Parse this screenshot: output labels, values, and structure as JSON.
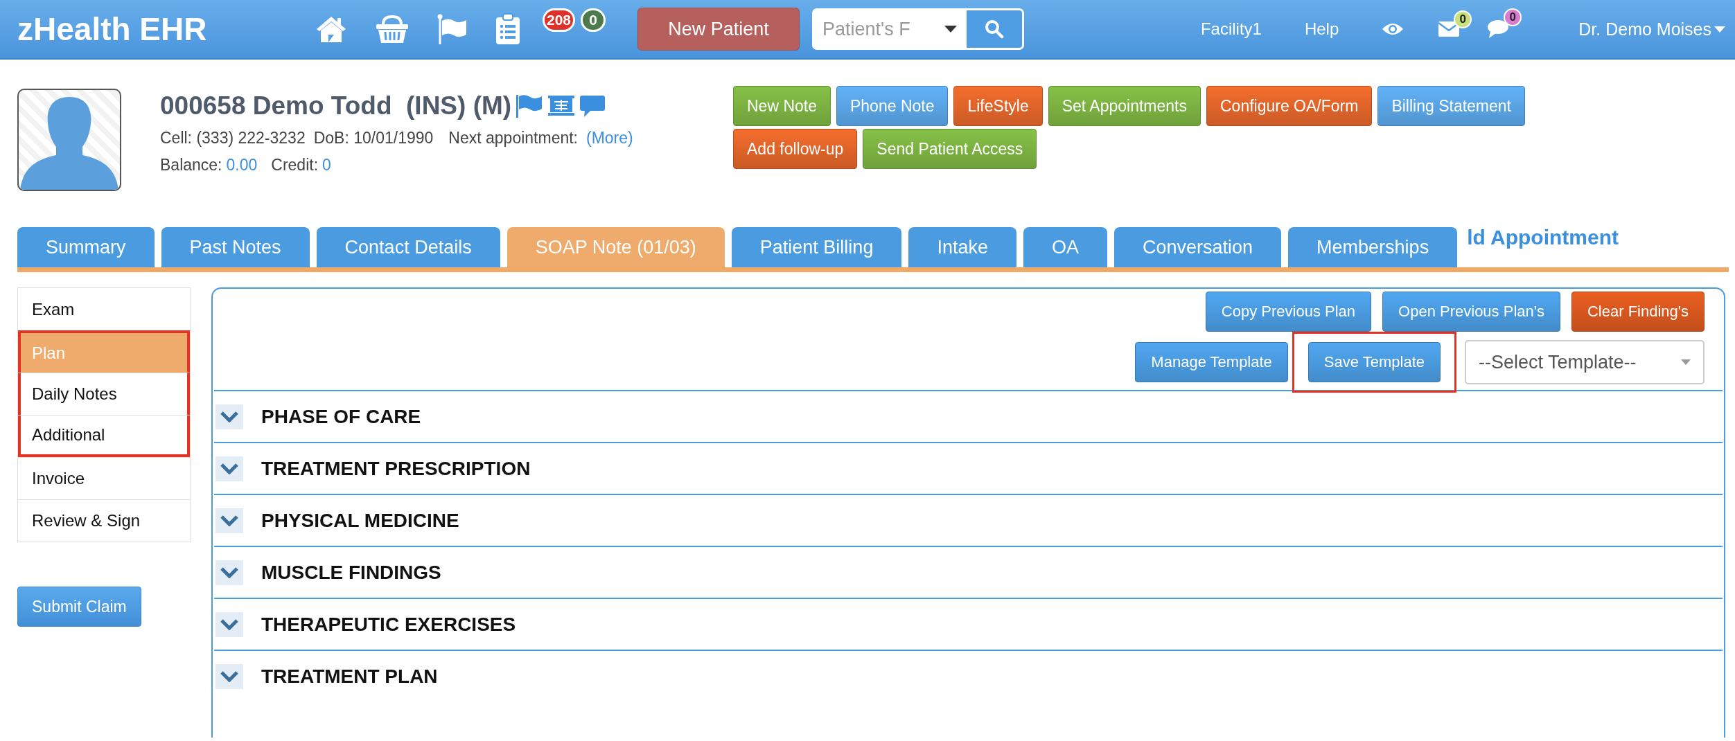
{
  "header": {
    "logo": "zHealth EHR",
    "badges": [
      {
        "count": "208",
        "color": "#e0302a"
      },
      {
        "count": "0",
        "color": "#4d7a4a"
      }
    ],
    "new_patient": "New Patient",
    "search": {
      "placeholder": "Patient's F"
    },
    "links": [
      "Facility1",
      "Help"
    ],
    "notify": [
      {
        "count": "0",
        "color": "#c9e07a"
      },
      {
        "count": "0",
        "color": "#d97bd0"
      }
    ],
    "user": "Dr. Demo Moises"
  },
  "patient": {
    "name": "000658 Demo Todd  (INS) (M)",
    "cell_label": "Cell:",
    "cell": "(333) 222-3232",
    "dob_label": "DoB:",
    "dob": "10/01/1990",
    "next_label": "Next appointment:",
    "next_link": "(More)",
    "balance_label": "Balance:",
    "balance": "0.00",
    "credit_label": "Credit:",
    "credit": "0",
    "actions": [
      [
        {
          "label": "New Note",
          "color": "#7cb342"
        },
        {
          "label": "Phone Note",
          "color": "#5aa5e6"
        },
        {
          "label": "LifeStyle",
          "color": "#e2652a"
        },
        {
          "label": "Set Appointments",
          "color": "#7cb342"
        },
        {
          "label": "Configure OA/Form",
          "color": "#e2652a"
        },
        {
          "label": "Billing Statement",
          "color": "#5aa5e6"
        }
      ],
      [
        {
          "label": "Add follow-up",
          "color": "#e2652a"
        },
        {
          "label": "Send Patient Access",
          "color": "#7cb342"
        }
      ]
    ]
  },
  "tabs": [
    {
      "label": "Summary",
      "selected": false
    },
    {
      "label": "Past Notes",
      "selected": false
    },
    {
      "label": "Contact Details",
      "selected": false
    },
    {
      "label": "SOAP Note (01/03)",
      "selected": true
    },
    {
      "label": "Patient Billing",
      "selected": false
    },
    {
      "label": "Intake",
      "selected": false
    },
    {
      "label": "OA",
      "selected": false
    },
    {
      "label": "Conversation",
      "selected": false
    },
    {
      "label": "Memberships",
      "selected": false
    }
  ],
  "tab_trailing_link": "ld Appointment",
  "sidebar": {
    "items": [
      {
        "label": "Exam",
        "selected": false,
        "highlighted": false
      },
      {
        "label": "Plan",
        "selected": true,
        "highlighted": true
      },
      {
        "label": "Daily Notes",
        "selected": false,
        "highlighted": true
      },
      {
        "label": "Additional",
        "selected": false,
        "highlighted": true
      },
      {
        "label": "Invoice",
        "selected": false,
        "highlighted": false
      },
      {
        "label": "Review & Sign",
        "selected": false,
        "highlighted": false
      }
    ],
    "submit": "Submit Claim"
  },
  "plan": {
    "toolbar": [
      [
        {
          "label": "Copy Previous Plan",
          "color": "#4a9be0",
          "highlighted": false
        },
        {
          "label": "Open Previous Plan's",
          "color": "#4a9be0",
          "highlighted": false
        },
        {
          "label": "Clear Finding's",
          "color": "#d9581f",
          "highlighted": false
        }
      ],
      [
        {
          "label": "Manage Template",
          "color": "#4a9be0",
          "highlighted": false
        },
        {
          "label": "Save Template",
          "color": "#4a9be0",
          "highlighted": true
        }
      ]
    ],
    "template_select": "--Select Template--",
    "sections": [
      "PHASE OF CARE",
      "TREATMENT PRESCRIPTION",
      "PHYSICAL MEDICINE",
      "MUSCLE FINDINGS",
      "THERAPEUTIC EXERCISES",
      "TREATMENT PLAN"
    ]
  }
}
